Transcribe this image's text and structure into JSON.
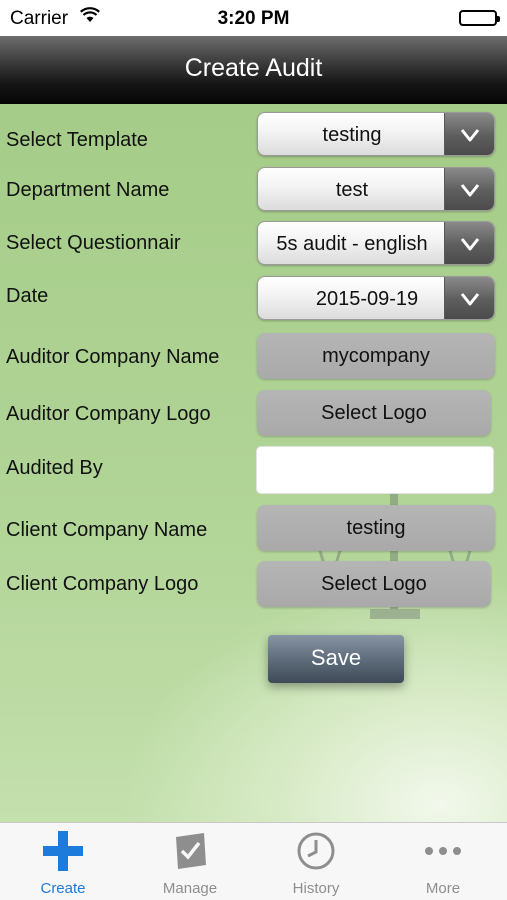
{
  "status_bar": {
    "carrier": "Carrier",
    "time": "3:20 PM"
  },
  "nav": {
    "title": "Create Audit"
  },
  "form": {
    "select_template": {
      "label": "Select Template",
      "value": "testing"
    },
    "department_name": {
      "label": "Department Name",
      "value": "test"
    },
    "select_questionnaire": {
      "label": "Select Questionnair",
      "value": "5s audit - english"
    },
    "date": {
      "label": "Date",
      "value": "2015-09-19"
    },
    "auditor_company_name": {
      "label": "Auditor Company Name",
      "value": "mycompany"
    },
    "auditor_company_logo": {
      "label": "Auditor Company Logo",
      "button": "Select Logo"
    },
    "audited_by": {
      "label": "Audited By",
      "value": ""
    },
    "client_company_name": {
      "label": "Client Company Name",
      "value": "testing"
    },
    "client_company_logo": {
      "label": "Client Company Logo",
      "button": "Select Logo"
    },
    "save_label": "Save"
  },
  "tabs": [
    {
      "label": "Create",
      "icon": "plus-icon",
      "active": true
    },
    {
      "label": "Manage",
      "icon": "clipboard-check-icon",
      "active": false
    },
    {
      "label": "History",
      "icon": "clock-icon",
      "active": false
    },
    {
      "label": "More",
      "icon": "more-dots-icon",
      "active": false
    }
  ],
  "colors": {
    "accent": "#1d7bdc",
    "background": "#a9cf8d",
    "nav_bar": "#161616",
    "save_button": "#5f6d7c"
  }
}
